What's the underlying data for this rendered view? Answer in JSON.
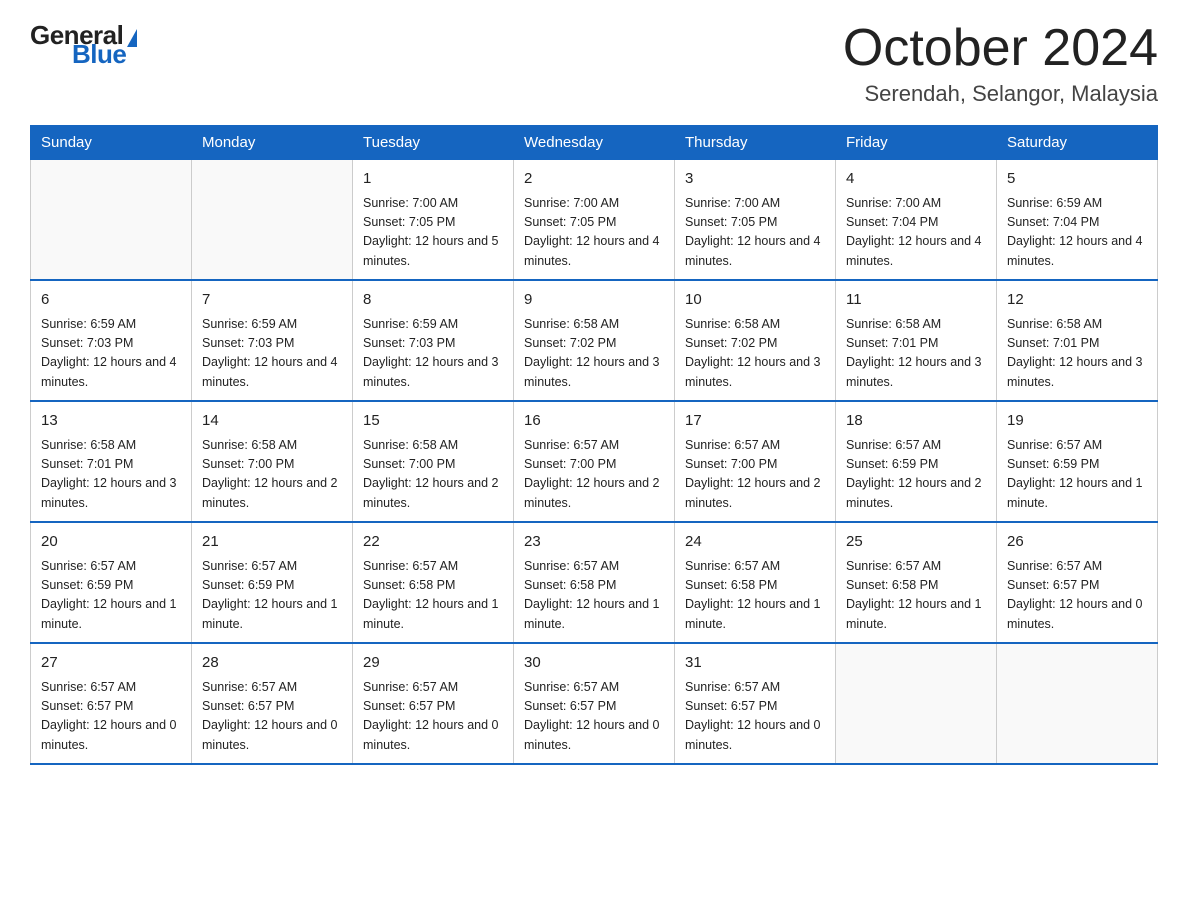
{
  "logo": {
    "general": "General",
    "triangle": "▶",
    "blue": "Blue"
  },
  "title": {
    "month": "October 2024",
    "location": "Serendah, Selangor, Malaysia"
  },
  "headers": [
    "Sunday",
    "Monday",
    "Tuesday",
    "Wednesday",
    "Thursday",
    "Friday",
    "Saturday"
  ],
  "weeks": [
    [
      {
        "day": "",
        "sunrise": "",
        "sunset": "",
        "daylight": ""
      },
      {
        "day": "",
        "sunrise": "",
        "sunset": "",
        "daylight": ""
      },
      {
        "day": "1",
        "sunrise": "Sunrise: 7:00 AM",
        "sunset": "Sunset: 7:05 PM",
        "daylight": "Daylight: 12 hours and 5 minutes."
      },
      {
        "day": "2",
        "sunrise": "Sunrise: 7:00 AM",
        "sunset": "Sunset: 7:05 PM",
        "daylight": "Daylight: 12 hours and 4 minutes."
      },
      {
        "day": "3",
        "sunrise": "Sunrise: 7:00 AM",
        "sunset": "Sunset: 7:05 PM",
        "daylight": "Daylight: 12 hours and 4 minutes."
      },
      {
        "day": "4",
        "sunrise": "Sunrise: 7:00 AM",
        "sunset": "Sunset: 7:04 PM",
        "daylight": "Daylight: 12 hours and 4 minutes."
      },
      {
        "day": "5",
        "sunrise": "Sunrise: 6:59 AM",
        "sunset": "Sunset: 7:04 PM",
        "daylight": "Daylight: 12 hours and 4 minutes."
      }
    ],
    [
      {
        "day": "6",
        "sunrise": "Sunrise: 6:59 AM",
        "sunset": "Sunset: 7:03 PM",
        "daylight": "Daylight: 12 hours and 4 minutes."
      },
      {
        "day": "7",
        "sunrise": "Sunrise: 6:59 AM",
        "sunset": "Sunset: 7:03 PM",
        "daylight": "Daylight: 12 hours and 4 minutes."
      },
      {
        "day": "8",
        "sunrise": "Sunrise: 6:59 AM",
        "sunset": "Sunset: 7:03 PM",
        "daylight": "Daylight: 12 hours and 3 minutes."
      },
      {
        "day": "9",
        "sunrise": "Sunrise: 6:58 AM",
        "sunset": "Sunset: 7:02 PM",
        "daylight": "Daylight: 12 hours and 3 minutes."
      },
      {
        "day": "10",
        "sunrise": "Sunrise: 6:58 AM",
        "sunset": "Sunset: 7:02 PM",
        "daylight": "Daylight: 12 hours and 3 minutes."
      },
      {
        "day": "11",
        "sunrise": "Sunrise: 6:58 AM",
        "sunset": "Sunset: 7:01 PM",
        "daylight": "Daylight: 12 hours and 3 minutes."
      },
      {
        "day": "12",
        "sunrise": "Sunrise: 6:58 AM",
        "sunset": "Sunset: 7:01 PM",
        "daylight": "Daylight: 12 hours and 3 minutes."
      }
    ],
    [
      {
        "day": "13",
        "sunrise": "Sunrise: 6:58 AM",
        "sunset": "Sunset: 7:01 PM",
        "daylight": "Daylight: 12 hours and 3 minutes."
      },
      {
        "day": "14",
        "sunrise": "Sunrise: 6:58 AM",
        "sunset": "Sunset: 7:00 PM",
        "daylight": "Daylight: 12 hours and 2 minutes."
      },
      {
        "day": "15",
        "sunrise": "Sunrise: 6:58 AM",
        "sunset": "Sunset: 7:00 PM",
        "daylight": "Daylight: 12 hours and 2 minutes."
      },
      {
        "day": "16",
        "sunrise": "Sunrise: 6:57 AM",
        "sunset": "Sunset: 7:00 PM",
        "daylight": "Daylight: 12 hours and 2 minutes."
      },
      {
        "day": "17",
        "sunrise": "Sunrise: 6:57 AM",
        "sunset": "Sunset: 7:00 PM",
        "daylight": "Daylight: 12 hours and 2 minutes."
      },
      {
        "day": "18",
        "sunrise": "Sunrise: 6:57 AM",
        "sunset": "Sunset: 6:59 PM",
        "daylight": "Daylight: 12 hours and 2 minutes."
      },
      {
        "day": "19",
        "sunrise": "Sunrise: 6:57 AM",
        "sunset": "Sunset: 6:59 PM",
        "daylight": "Daylight: 12 hours and 1 minute."
      }
    ],
    [
      {
        "day": "20",
        "sunrise": "Sunrise: 6:57 AM",
        "sunset": "Sunset: 6:59 PM",
        "daylight": "Daylight: 12 hours and 1 minute."
      },
      {
        "day": "21",
        "sunrise": "Sunrise: 6:57 AM",
        "sunset": "Sunset: 6:59 PM",
        "daylight": "Daylight: 12 hours and 1 minute."
      },
      {
        "day": "22",
        "sunrise": "Sunrise: 6:57 AM",
        "sunset": "Sunset: 6:58 PM",
        "daylight": "Daylight: 12 hours and 1 minute."
      },
      {
        "day": "23",
        "sunrise": "Sunrise: 6:57 AM",
        "sunset": "Sunset: 6:58 PM",
        "daylight": "Daylight: 12 hours and 1 minute."
      },
      {
        "day": "24",
        "sunrise": "Sunrise: 6:57 AM",
        "sunset": "Sunset: 6:58 PM",
        "daylight": "Daylight: 12 hours and 1 minute."
      },
      {
        "day": "25",
        "sunrise": "Sunrise: 6:57 AM",
        "sunset": "Sunset: 6:58 PM",
        "daylight": "Daylight: 12 hours and 1 minute."
      },
      {
        "day": "26",
        "sunrise": "Sunrise: 6:57 AM",
        "sunset": "Sunset: 6:57 PM",
        "daylight": "Daylight: 12 hours and 0 minutes."
      }
    ],
    [
      {
        "day": "27",
        "sunrise": "Sunrise: 6:57 AM",
        "sunset": "Sunset: 6:57 PM",
        "daylight": "Daylight: 12 hours and 0 minutes."
      },
      {
        "day": "28",
        "sunrise": "Sunrise: 6:57 AM",
        "sunset": "Sunset: 6:57 PM",
        "daylight": "Daylight: 12 hours and 0 minutes."
      },
      {
        "day": "29",
        "sunrise": "Sunrise: 6:57 AM",
        "sunset": "Sunset: 6:57 PM",
        "daylight": "Daylight: 12 hours and 0 minutes."
      },
      {
        "day": "30",
        "sunrise": "Sunrise: 6:57 AM",
        "sunset": "Sunset: 6:57 PM",
        "daylight": "Daylight: 12 hours and 0 minutes."
      },
      {
        "day": "31",
        "sunrise": "Sunrise: 6:57 AM",
        "sunset": "Sunset: 6:57 PM",
        "daylight": "Daylight: 12 hours and 0 minutes."
      },
      {
        "day": "",
        "sunrise": "",
        "sunset": "",
        "daylight": ""
      },
      {
        "day": "",
        "sunrise": "",
        "sunset": "",
        "daylight": ""
      }
    ]
  ]
}
